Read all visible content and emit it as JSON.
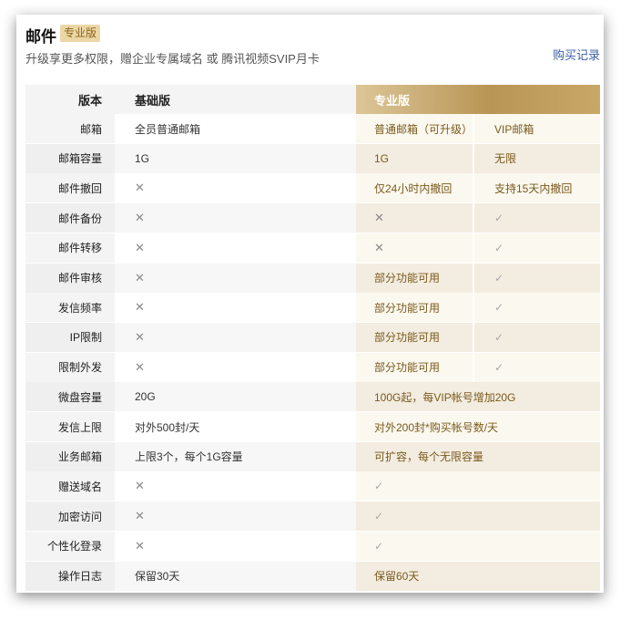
{
  "page": {
    "title": "邮件",
    "badge": "专业版",
    "subtitle": "升级享更多权限，赠企业专属域名 或 腾讯视频SVIP月卡",
    "purchase_link": "购买记录"
  },
  "table": {
    "header": {
      "version": "版本",
      "basic": "基础版",
      "pro": "专业版"
    },
    "rows": [
      {
        "label": "邮箱",
        "basic": "全员普通邮箱",
        "pro1": "普通邮箱（可升级）",
        "pro2": "VIP邮箱"
      },
      {
        "label": "邮箱容量",
        "basic": "1G",
        "pro1": "1G",
        "pro2": "无限"
      },
      {
        "label": "邮件撤回",
        "basic": "✕",
        "pro1": "仅24小时内撤回",
        "pro2": "支持15天内撤回"
      },
      {
        "label": "邮件备份",
        "basic": "✕",
        "pro1": "✕",
        "pro2": "✓"
      },
      {
        "label": "邮件转移",
        "basic": "✕",
        "pro1": "✕",
        "pro2": "✓"
      },
      {
        "label": "邮件审核",
        "basic": "✕",
        "pro1": "部分功能可用",
        "pro2": "✓"
      },
      {
        "label": "发信频率",
        "basic": "✕",
        "pro1": "部分功能可用",
        "pro2": "✓"
      },
      {
        "label": "IP限制",
        "basic": "✕",
        "pro1": "部分功能可用",
        "pro2": "✓"
      },
      {
        "label": "限制外发",
        "basic": "✕",
        "pro1": "部分功能可用",
        "pro2": "✓"
      },
      {
        "label": "微盘容量",
        "basic": "20G",
        "pro": "100G起，每VIP帐号增加20G"
      },
      {
        "label": "发信上限",
        "basic": "对外500封/天",
        "pro": "对外200封*购买帐号数/天"
      },
      {
        "label": "业务邮箱",
        "basic": "上限3个，每个1G容量",
        "pro": "可扩容，每个无限容量"
      },
      {
        "label": "赠送域名",
        "basic": "✕",
        "pro": "✓"
      },
      {
        "label": "加密访问",
        "basic": "✕",
        "pro": "✓"
      },
      {
        "label": "个性化登录",
        "basic": "✕",
        "pro": "✓"
      },
      {
        "label": "操作日志",
        "basic": "保留30天",
        "pro": "保留60天"
      }
    ]
  }
}
